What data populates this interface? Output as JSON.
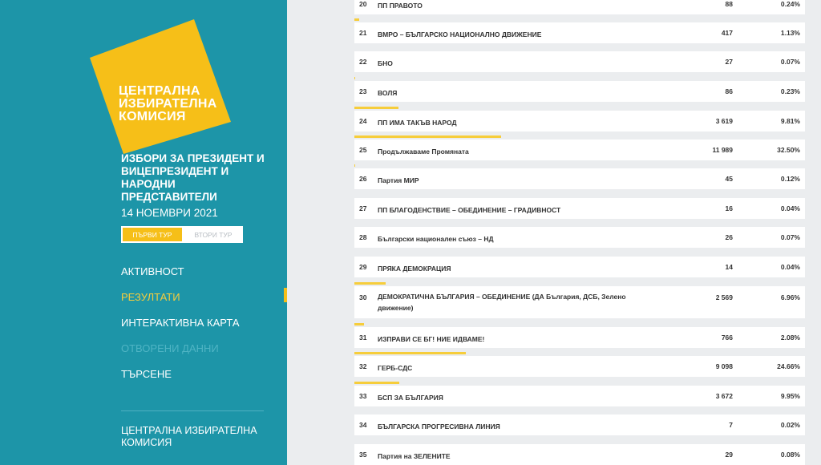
{
  "logo": {
    "lines": [
      "ЦЕНТРАЛНА",
      "ИЗБИРАТЕЛНА",
      "КОМИСИЯ"
    ],
    "color": "#f6bf18"
  },
  "election": {
    "title": "ИЗБОРИ ЗА ПРЕЗИДЕНТ И ВИЦЕПРЕЗИДЕНТ И НАРОДНИ ПРЕДСТАВИТЕЛИ",
    "date": "14 НОЕМВРИ 2021"
  },
  "rounds": [
    {
      "label": "ПЪРВИ ТУР",
      "active": true
    },
    {
      "label": "ВТОРИ ТУР",
      "active": false
    }
  ],
  "nav": [
    {
      "label": "АКТИВНОСТ",
      "state": "normal"
    },
    {
      "label": "РЕЗУЛТАТИ",
      "state": "active"
    },
    {
      "label": "ИНТЕРАКТИВНА КАРТА",
      "state": "normal"
    },
    {
      "label": "ОТВОРЕНИ ДАННИ",
      "state": "disabled"
    },
    {
      "label": "ТЪРСЕНЕ",
      "state": "normal"
    }
  ],
  "footer": {
    "text": "ЦЕНТРАЛНА ИЗБИРАТЕЛНА КОМИСИЯ"
  },
  "results": [
    {
      "num": "20",
      "name": "ПП ПРАВОТО",
      "votes": "88",
      "percent": "0.24%"
    },
    {
      "num": "21",
      "name": "ВМРО – БЪЛГАРСКО НАЦИОНАЛНО ДВИЖЕНИЕ",
      "votes": "417",
      "percent": "1.13%"
    },
    {
      "num": "22",
      "name": "БНО",
      "votes": "27",
      "percent": "0.07%"
    },
    {
      "num": "23",
      "name": "ВОЛЯ",
      "votes": "86",
      "percent": "0.23%"
    },
    {
      "num": "24",
      "name": "ПП ИМА ТАКЪВ НАРОД",
      "votes": "3 619",
      "percent": "9.81%"
    },
    {
      "num": "25",
      "name": "Продължаваме Промяната",
      "votes": "11 989",
      "percent": "32.50%"
    },
    {
      "num": "26",
      "name": "Партия МИР",
      "votes": "45",
      "percent": "0.12%"
    },
    {
      "num": "27",
      "name": "ПП БЛАГОДЕНСТВИЕ – ОБЕДИНЕНИЕ – ГРАДИВНОСТ",
      "votes": "16",
      "percent": "0.04%"
    },
    {
      "num": "28",
      "name": "Български национален съюз – НД",
      "votes": "26",
      "percent": "0.07%"
    },
    {
      "num": "29",
      "name": "ПРЯКА ДЕМОКРАЦИЯ",
      "votes": "14",
      "percent": "0.04%"
    },
    {
      "num": "30",
      "name": "ДЕМОКРАТИЧНА БЪЛГАРИЯ – ОБЕДИНЕНИЕ (ДА България, ДСБ, Зелено движение)",
      "votes": "2 569",
      "percent": "6.96%"
    },
    {
      "num": "31",
      "name": "ИЗПРАВИ СЕ БГ! НИЕ ИДВАМЕ!",
      "votes": "766",
      "percent": "2.08%"
    },
    {
      "num": "32",
      "name": "ГЕРБ-СДС",
      "votes": "9 098",
      "percent": "24.66%"
    },
    {
      "num": "33",
      "name": "БСП ЗА БЪЛГАРИЯ",
      "votes": "3 672",
      "percent": "9.95%"
    },
    {
      "num": "34",
      "name": "БЪЛГАРСКА ПРОГРЕСИВНА ЛИНИЯ",
      "votes": "7",
      "percent": "0.02%"
    },
    {
      "num": "35",
      "name": "Партия на ЗЕЛЕНИТЕ",
      "votes": "29",
      "percent": "0.08%"
    }
  ]
}
